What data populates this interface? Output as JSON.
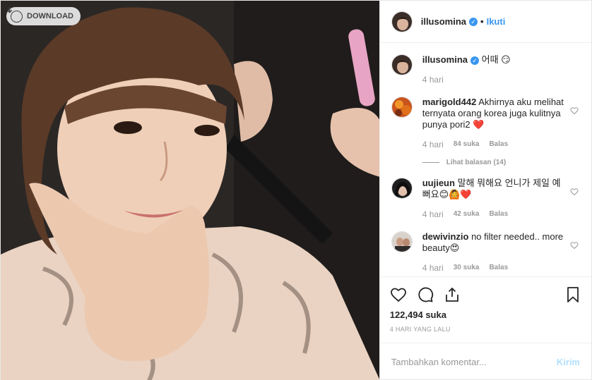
{
  "download": {
    "label": "DOWNLOAD"
  },
  "header": {
    "username": "illusomina",
    "separator": "•",
    "follow_label": "Ikuti"
  },
  "caption": {
    "username": "illusomina",
    "text": "어때 😏",
    "time": "4 hari"
  },
  "comments": [
    {
      "username": "marigold442",
      "text": "Akhirnya aku melihat ternyata orang korea juga kulitnya punya pori2 ❤️",
      "time": "4 hari",
      "likes": "84 suka",
      "reply": "Balas",
      "view_replies": "Lihat balasan (14)"
    },
    {
      "username": "uujieun",
      "text": "말해 뭐해요 언니가 제일 예뻐요😊🙆❤️",
      "time": "4 hari",
      "likes": "42 suka",
      "reply": "Balas"
    },
    {
      "username": "dewivinzio",
      "text": "no filter needed.. more beauty😍",
      "time": "4 hari",
      "likes": "30 suka",
      "reply": "Balas"
    }
  ],
  "post": {
    "likes": "122,494 suka",
    "time_ago": "4 HARI YANG LALU"
  },
  "add_comment": {
    "placeholder": "Tambahkan komentar...",
    "post_label": "Kirim"
  },
  "colors": {
    "accent": "#3897f0",
    "muted": "#999999",
    "heart_red": "#ed4956",
    "post_disabled": "#b2dffc"
  },
  "icons": [
    "download-icon",
    "verified-icon",
    "heart-icon",
    "comment-icon",
    "share-icon",
    "bookmark-icon"
  ]
}
